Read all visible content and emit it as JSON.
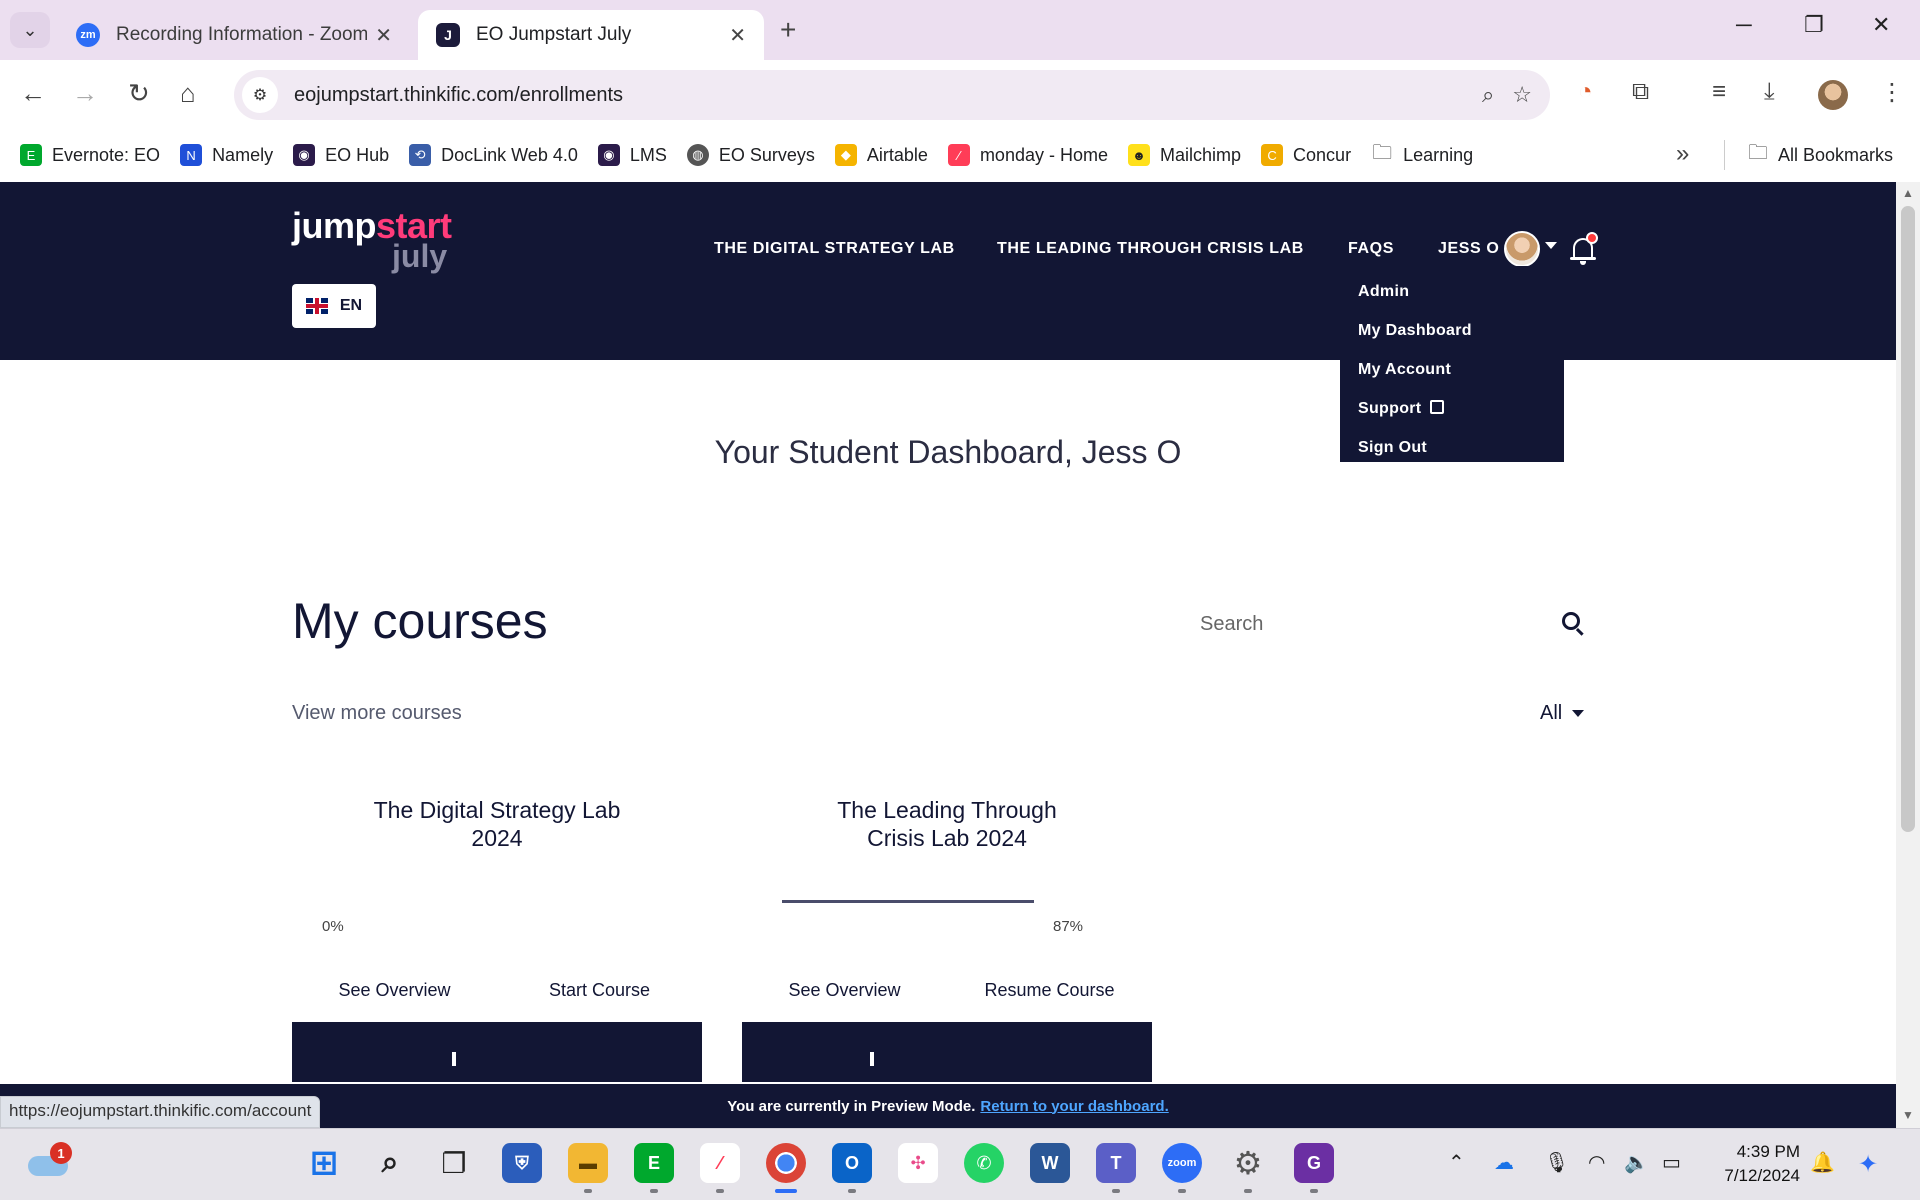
{
  "browser": {
    "tabs": [
      {
        "title": "Recording Information - Zoom",
        "favicon": "zoom-icon",
        "active": false
      },
      {
        "title": "EO Jumpstart July",
        "favicon": "j-icon",
        "active": true
      }
    ],
    "url": "eojumpstart.thinkific.com/enrollments",
    "bookmarks": [
      {
        "label": "Evernote: EO",
        "icon": "evernote-icon",
        "color": "#00a82d"
      },
      {
        "label": "Namely",
        "icon": "namely-icon",
        "color": "#1f4fd8"
      },
      {
        "label": "EO Hub",
        "icon": "eo-hub-icon",
        "color": "#2b1b4a"
      },
      {
        "label": "DocLink Web 4.0",
        "icon": "doclink-icon",
        "color": "#3a5ea8"
      },
      {
        "label": "LMS",
        "icon": "lms-icon",
        "color": "#2b1b4a"
      },
      {
        "label": "EO Surveys",
        "icon": "globe-icon",
        "color": "#555555"
      },
      {
        "label": "Airtable",
        "icon": "airtable-icon",
        "color": "#f5b400"
      },
      {
        "label": "monday - Home",
        "icon": "monday-icon",
        "color": "#ff3d57"
      },
      {
        "label": "Mailchimp",
        "icon": "mailchimp-icon",
        "color": "#ffe01b"
      },
      {
        "label": "Concur",
        "icon": "concur-icon",
        "color": "#f0ab00"
      },
      {
        "label": "Learning",
        "icon": "folder-icon",
        "color": "#555555"
      }
    ],
    "all_bookmarks": "All Bookmarks",
    "status_url": "https://eojumpstart.thinkific.com/account"
  },
  "site": {
    "logo": {
      "part1": "jump",
      "part2": "start",
      "part3": "july"
    },
    "language": "EN",
    "nav": {
      "digital": "THE DIGITAL STRATEGY LAB",
      "crisis": "THE LEADING THROUGH CRISIS LAB",
      "faqs": "FAQS",
      "user": "JESS O"
    },
    "user_menu": {
      "admin": "Admin",
      "dashboard": "My Dashboard",
      "account": "My Account",
      "support": "Support",
      "signout": "Sign Out"
    },
    "dashboard_title": "Your Student Dashboard, Jess O",
    "courses_heading": "My courses",
    "search_placeholder": "Search",
    "view_more": "View more courses",
    "filter": "All",
    "courses": [
      {
        "title": "The Digital Strategy Lab 2024",
        "progress": 0,
        "progress_label": "0%",
        "overview": "See Overview",
        "action": "Start Course"
      },
      {
        "title": "The Leading Through Crisis Lab 2024",
        "progress": 87,
        "progress_label": "87%",
        "overview": "See Overview",
        "action": "Resume Course"
      }
    ],
    "preview": {
      "text": "You are currently in Preview Mode.",
      "link": "Return to your dashboard."
    }
  },
  "taskbar": {
    "weather_badge": "1",
    "time": "4:39 PM",
    "date": "7/12/2024"
  }
}
